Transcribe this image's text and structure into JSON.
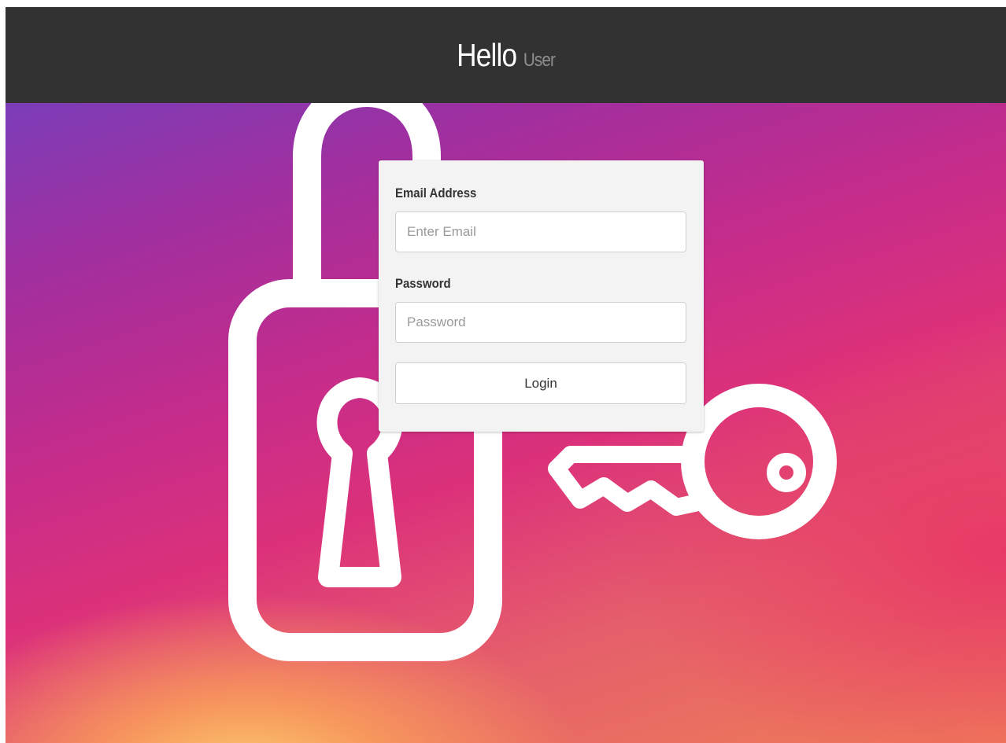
{
  "header": {
    "greeting": "Hello",
    "user": "User"
  },
  "login_form": {
    "email": {
      "label": "Email Address",
      "placeholder": "Enter Email",
      "value": ""
    },
    "password": {
      "label": "Password",
      "placeholder": "Password",
      "value": ""
    },
    "submit_label": "Login"
  },
  "background": {
    "illustration": [
      "padlock-icon",
      "key-icon"
    ],
    "colors": {
      "header": "#323232",
      "gradient_top_left": "#7b3db8",
      "gradient_mid": "#d93080",
      "gradient_bottom": "#fbd06e",
      "card": "#f3f3f3"
    }
  }
}
